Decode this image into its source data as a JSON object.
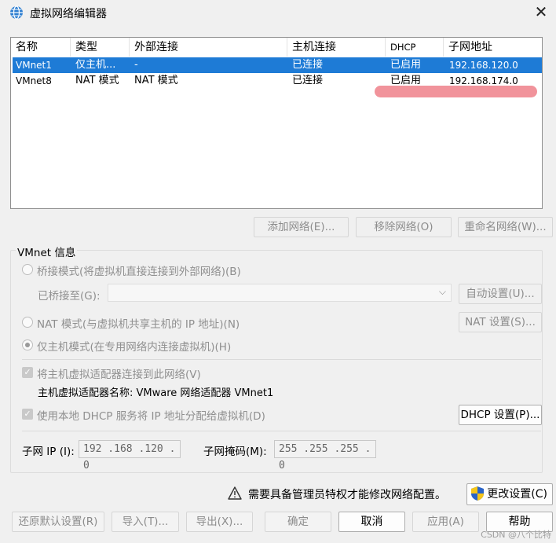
{
  "window": {
    "title": "虚拟网络编辑器",
    "close_glyph": "✕"
  },
  "table": {
    "columns": [
      "名称",
      "类型",
      "外部连接",
      "主机连接",
      "DHCP",
      "子网地址"
    ],
    "rows": [
      {
        "name": "VMnet1",
        "type": "仅主机...",
        "external": "-",
        "host": "已连接",
        "dhcp": "已启用",
        "subnet": "192.168.120.0",
        "selected": true
      },
      {
        "name": "VMnet8",
        "type": "NAT 模式",
        "external": "NAT 模式",
        "host": "已连接",
        "dhcp": "已启用",
        "subnet": "192.168.174.0",
        "selected": false
      }
    ]
  },
  "list_buttons": {
    "add": "添加网络(E)...",
    "remove": "移除网络(O)",
    "rename": "重命名网络(W)..."
  },
  "info": {
    "group_title": "VMnet 信息",
    "bridge_mode": "桥接模式(将虚拟机直接连接到外部网络)(B)",
    "bridged_to_label": "已桥接至(G):",
    "auto_settings": "自动设置(U)...",
    "nat_mode": "NAT 模式(与虚拟机共享主机的 IP 地址)(N)",
    "nat_settings": "NAT 设置(S)...",
    "host_only_mode": "仅主机模式(在专用网络内连接虚拟机)(H)",
    "connect_adapter": "将主机虚拟适配器连接到此网络(V)",
    "adapter_name": "主机虚拟适配器名称: VMware 网络适配器 VMnet1",
    "use_dhcp": "使用本地 DHCP 服务将 IP 地址分配给虚拟机(D)",
    "dhcp_settings": "DHCP 设置(P)...",
    "subnet_ip_label": "子网 IP (I):",
    "subnet_ip": "192 .168 .120 .  0",
    "subnet_mask_label": "子网掩码(M):",
    "subnet_mask": "255 .255 .255 .  0"
  },
  "admin": {
    "notice": "需要具备管理员特权才能修改网络配置。",
    "change_settings": "更改设置(C)"
  },
  "footer": {
    "restore": "还原默认设置(R)",
    "import": "导入(T)...",
    "export": "导出(X)...",
    "ok": "确定",
    "cancel": "取消",
    "apply": "应用(A)",
    "help": "帮助"
  },
  "watermark": "CSDN @八个比特",
  "colors": {
    "selection": "#1e7bd6",
    "annotation": "#f08d96",
    "shield_blue": "#2a64c8",
    "shield_yellow": "#f5c518"
  }
}
